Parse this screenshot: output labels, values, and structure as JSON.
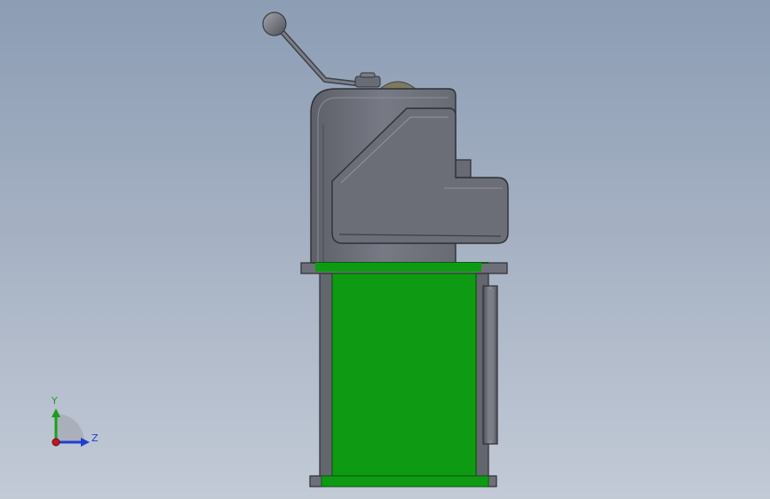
{
  "triad": {
    "y_label": "Y",
    "z_label": "Z",
    "x_color": "#c8141e",
    "y_color": "#1aa01a",
    "z_color": "#1f3fd0"
  },
  "colors": {
    "background_top": "#8c9db4",
    "background_bottom": "#c2cad6",
    "housing": "#6f717b",
    "housing_dark": "#4a4c55",
    "gearbox_body": "#0f9a13",
    "gearbox_dark": "#0a5e0c"
  }
}
